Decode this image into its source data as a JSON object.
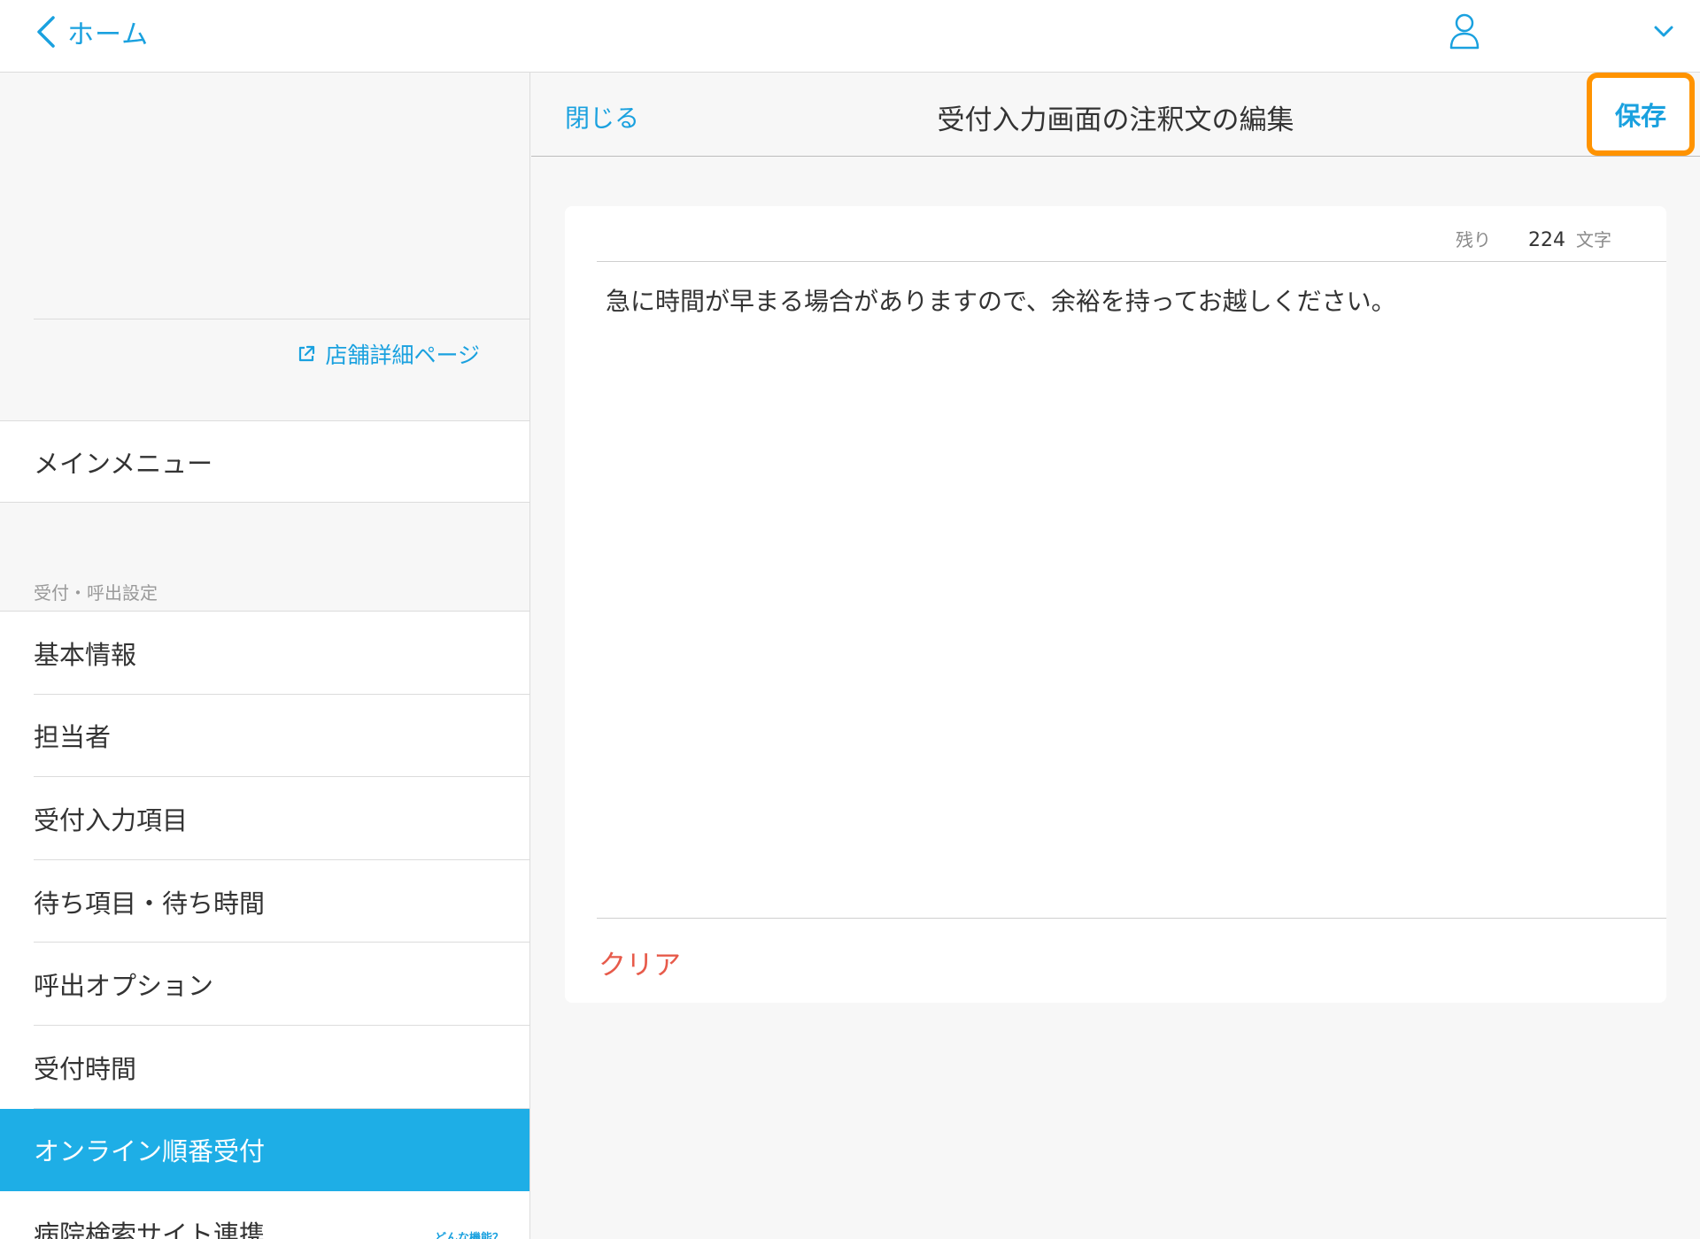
{
  "topbar": {
    "back_label": "ホーム"
  },
  "sidebar": {
    "store_link": "店舗詳細ページ",
    "main_menu": "メインメニュー",
    "section_label": "受付・呼出設定",
    "items": [
      {
        "label": "基本情報"
      },
      {
        "label": "担当者"
      },
      {
        "label": "受付入力項目"
      },
      {
        "label": "待ち項目・待ち時間"
      },
      {
        "label": "呼出オプション"
      },
      {
        "label": "受付時間"
      },
      {
        "label": "オンライン順番受付"
      },
      {
        "label": "病院検索サイト連携",
        "help": "どんな機能？"
      }
    ],
    "active_index": 6
  },
  "panel": {
    "close_label": "閉じる",
    "title": "受付入力画面の注釈文の編集",
    "save_label": "保存"
  },
  "editor": {
    "remaining_label": "残り",
    "remaining_count": "224",
    "unit_label": "文字",
    "text": "急に時間が早まる場合がありますので、余裕を持ってお越しください。",
    "clear_label": "クリア"
  },
  "colors": {
    "accent": "#1aa1df",
    "active_bg": "#1eaee6",
    "highlight": "#ff9300",
    "danger": "#e75a4a"
  }
}
